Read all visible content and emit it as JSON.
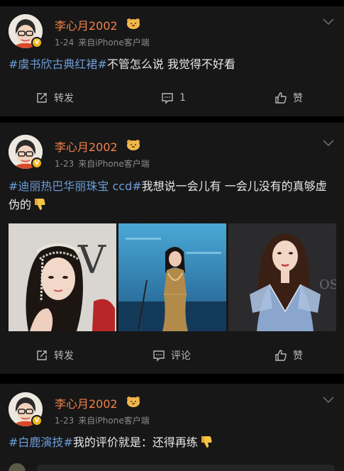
{
  "posts": [
    {
      "username": "李心月2002",
      "verified": "V",
      "date": "1-24",
      "source": "来自iPhone客户端",
      "hashtag": "#虞书欣古典红裙#",
      "text": "不管怎么说 我觉得不好看",
      "actions": {
        "repost": "转发",
        "comment": "1",
        "like": "赞"
      }
    },
    {
      "username": "李心月2002",
      "verified": "V",
      "date": "1-23",
      "source": "来自iPhone客户端",
      "hashtag": "#迪丽热巴华丽珠宝 ccd#",
      "text": "我想说一会儿有 一会儿没有的真够虚伪的",
      "images": [
        "headpiece-portrait",
        "stage-gold-dress",
        "blue-sequin-gown"
      ],
      "actions": {
        "repost": "转发",
        "comment": "评论",
        "like": "赞"
      }
    },
    {
      "username": "李心月2002",
      "verified": "V",
      "date": "1-23",
      "source": "来自iPhone客户端",
      "hashtag": "#白鹿演技#",
      "text": "我的评价就是：还得再练"
    }
  ],
  "icons": {
    "repost": "repost-icon",
    "comment": "comment-icon",
    "like": "thumbs-up-icon",
    "more": "chevron-down-icon",
    "emoji": "thumbs-down-emoji",
    "medal": "bear-medal-icon"
  },
  "colors": {
    "background": "#0b0b0b",
    "card": "#171717",
    "username": "#f0824a",
    "hashtag": "#6c9bd6",
    "meta": "#8a8a8a",
    "badge": "#f3b51c"
  }
}
